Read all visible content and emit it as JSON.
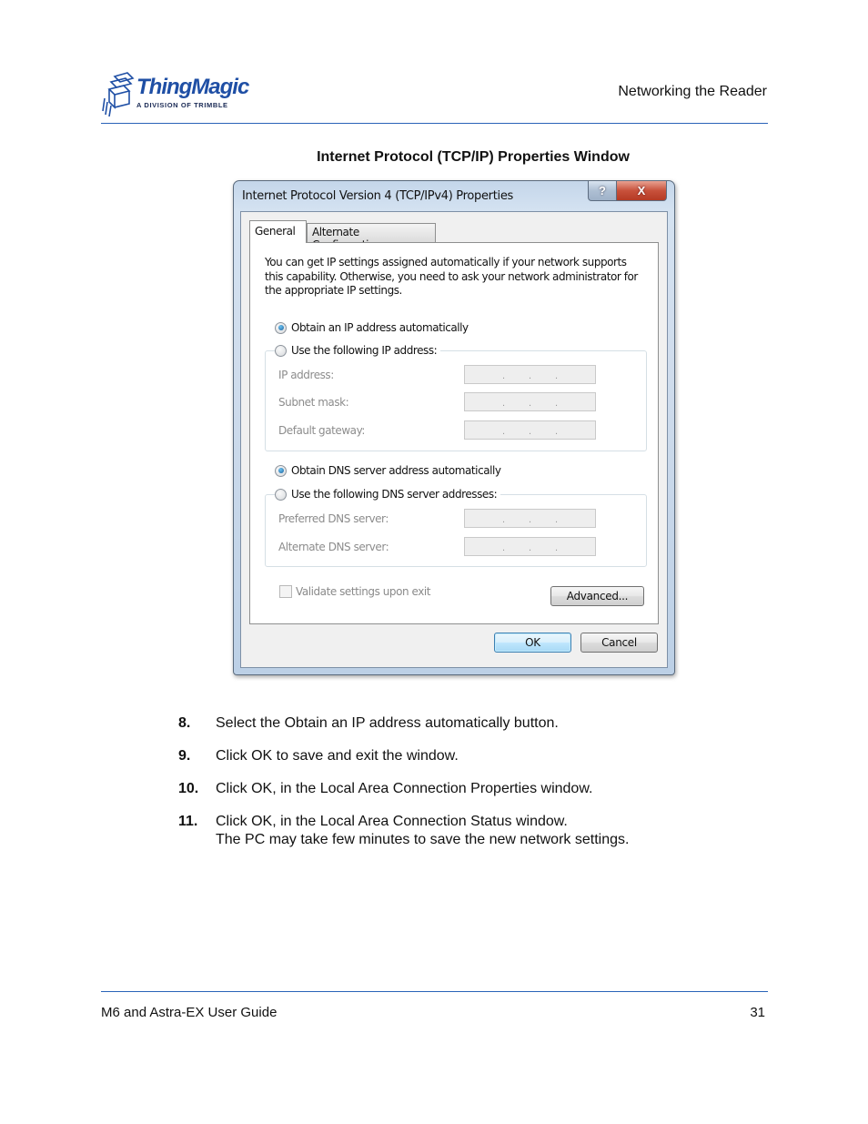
{
  "header": {
    "logo": {
      "brand": "ThingMagic",
      "tagline": "A DIVISION OF TRIMBLE",
      "brand_color": "#1f4fa5"
    },
    "section_title": "Networking the Reader",
    "rule_color": "#2a63b8"
  },
  "figure": {
    "caption": "Internet Protocol (TCP/IP) Properties Window",
    "dialog": {
      "title": "Internet Protocol Version 4 (TCP/IPv4) Properties",
      "title_buttons": {
        "help_glyph": "?",
        "close_glyph": "X"
      },
      "tabs": [
        {
          "label": "General",
          "active": true
        },
        {
          "label": "Alternate Configuration",
          "active": false
        }
      ],
      "intro_text": "You can get IP settings assigned automatically if your network supports this capability. Otherwise, you need to ask your network administrator for the appropriate IP settings.",
      "ip_options": {
        "auto_label": "Obtain an IP address automatically",
        "auto_selected": true,
        "manual_label": "Use the following IP address:",
        "manual_selected": false,
        "fields": [
          {
            "label": "IP address:",
            "value": " .   .   . "
          },
          {
            "label": "Subnet mask:",
            "value": " .   .   . "
          },
          {
            "label": "Default gateway:",
            "value": " .   .   . "
          }
        ]
      },
      "dns_options": {
        "auto_label": "Obtain DNS server address automatically",
        "auto_selected": true,
        "manual_label": "Use the following DNS server addresses:",
        "manual_selected": false,
        "fields": [
          {
            "label": "Preferred DNS server:",
            "value": " .   .   . "
          },
          {
            "label": "Alternate DNS server:",
            "value": " .   .   . "
          }
        ]
      },
      "validate_checkbox": {
        "label": "Validate settings upon exit",
        "checked": false,
        "enabled": false
      },
      "buttons": {
        "advanced": "Advanced...",
        "ok": "OK",
        "cancel": "Cancel"
      }
    }
  },
  "steps": [
    {
      "number": "8.",
      "lines": [
        "Select the Obtain an IP address automatically button."
      ]
    },
    {
      "number": "9.",
      "lines": [
        "Click OK to save and exit the window."
      ]
    },
    {
      "number": "10.",
      "lines": [
        "Click OK, in the Local Area Connection Properties window."
      ]
    },
    {
      "number": "11.",
      "lines": [
        "Click OK, in the Local Area Connection Status window.",
        "The PC may take few minutes to save the new network settings."
      ]
    }
  ],
  "footer": {
    "document_title": "M6 and Astra-EX User Guide",
    "page_number": "31"
  }
}
